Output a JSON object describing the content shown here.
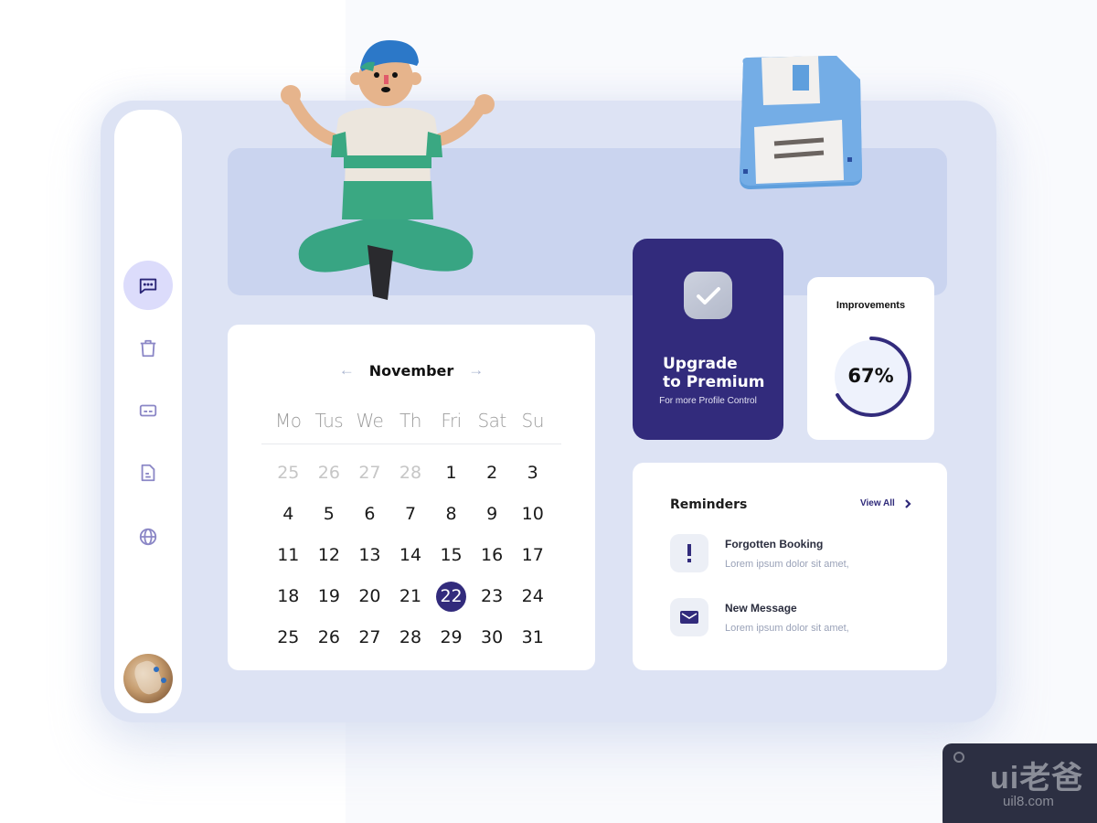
{
  "sidebar": {
    "items": [
      {
        "name": "messages",
        "icon": "chat-bubble-icon",
        "active": true
      },
      {
        "name": "trash",
        "icon": "trash-icon",
        "active": false
      },
      {
        "name": "payments",
        "icon": "credit-card-icon",
        "active": false
      },
      {
        "name": "documents",
        "icon": "document-icon",
        "active": false
      },
      {
        "name": "web",
        "icon": "globe-icon",
        "active": false
      }
    ],
    "avatar": "user-avatar"
  },
  "calendar": {
    "prev_icon": "←",
    "next_icon": "→",
    "month": "November",
    "weekdays": [
      "Mo",
      "Tus",
      "We",
      "Th",
      "Fri",
      "Sat",
      "Su"
    ],
    "days": [
      {
        "n": "25",
        "muted": true
      },
      {
        "n": "26",
        "muted": true
      },
      {
        "n": "27",
        "muted": true
      },
      {
        "n": "28",
        "muted": true
      },
      {
        "n": "1"
      },
      {
        "n": "2"
      },
      {
        "n": "3"
      },
      {
        "n": "4"
      },
      {
        "n": "5"
      },
      {
        "n": "6"
      },
      {
        "n": "7"
      },
      {
        "n": "8"
      },
      {
        "n": "9"
      },
      {
        "n": "10"
      },
      {
        "n": "11"
      },
      {
        "n": "12"
      },
      {
        "n": "13"
      },
      {
        "n": "14"
      },
      {
        "n": "15"
      },
      {
        "n": "16"
      },
      {
        "n": "17"
      },
      {
        "n": "18"
      },
      {
        "n": "19"
      },
      {
        "n": "20"
      },
      {
        "n": "21"
      },
      {
        "n": "22",
        "selected": true
      },
      {
        "n": "23"
      },
      {
        "n": "24"
      },
      {
        "n": "25"
      },
      {
        "n": "26"
      },
      {
        "n": "27"
      },
      {
        "n": "28"
      },
      {
        "n": "29"
      },
      {
        "n": "30"
      },
      {
        "n": "31"
      }
    ]
  },
  "premium": {
    "title_line1": "Upgrade",
    "title_line2": "to Premium",
    "subtitle": "For more Profile Control",
    "icon": "checkmark-icon"
  },
  "improvements": {
    "label": "Improvements",
    "percent_text": "67%",
    "progress": 0.67
  },
  "reminders": {
    "title": "Reminders",
    "view_all": "View All",
    "items": [
      {
        "icon": "exclamation-icon",
        "title": "Forgotten Booking",
        "subtitle": "Lorem ipsum dolor sit amet,"
      },
      {
        "icon": "envelope-icon",
        "title": "New Message",
        "subtitle": "Lorem ipsum dolor sit amet,"
      }
    ]
  },
  "watermark": {
    "logo": "ui老爸",
    "url": "uil8.com"
  },
  "colors": {
    "accent": "#322b7c",
    "panel": "#dde3f4",
    "banner": "#cad4ef",
    "active_bg": "#dcdcfb",
    "icon": "#8b87c6"
  }
}
